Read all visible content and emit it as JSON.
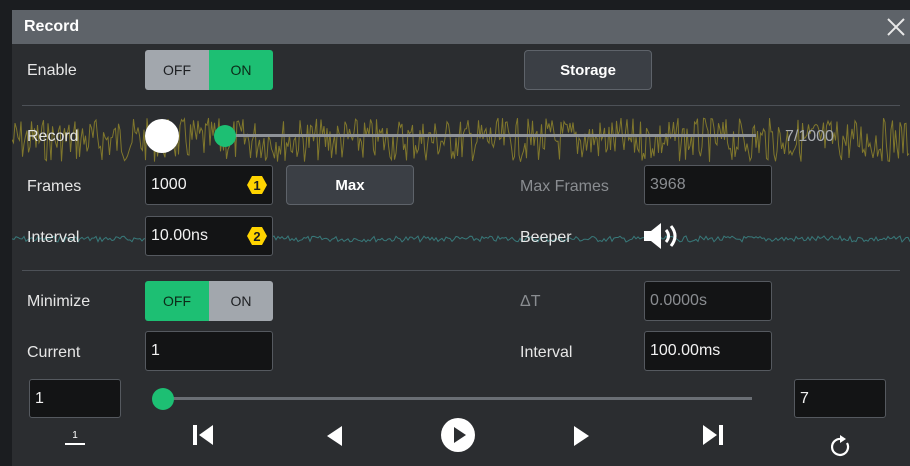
{
  "dialog": {
    "title": "Record"
  },
  "enable": {
    "label": "Enable",
    "off_label": "OFF",
    "on_label": "ON",
    "state": "on"
  },
  "storage_button": {
    "label": "Storage"
  },
  "record": {
    "label": "Record",
    "progress_text": "7/1000",
    "progress_fraction": 0.007
  },
  "frames": {
    "label": "Frames",
    "value": "1000",
    "badge": "1"
  },
  "max_button": {
    "label": "Max"
  },
  "max_frames": {
    "label": "Max Frames",
    "value": "3968"
  },
  "interval_top": {
    "label": "Interval",
    "value": "10.00ns",
    "badge": "2"
  },
  "beeper": {
    "label": "Beeper",
    "icon": "speaker-icon"
  },
  "minimize": {
    "label": "Minimize",
    "off_label": "OFF",
    "on_label": "ON",
    "state": "off"
  },
  "delta_t": {
    "label": "ΔT",
    "value": "0.0000s"
  },
  "current": {
    "label": "Current",
    "value": "1"
  },
  "interval_bottom": {
    "label": "Interval",
    "value": "100.00ms"
  },
  "range": {
    "start": "1",
    "end": "7",
    "position_fraction": 0.0
  },
  "playback": {
    "icons": [
      "set-start-icon",
      "skip-to-first-icon",
      "step-back-icon",
      "play-icon",
      "step-forward-icon",
      "skip-to-last-icon",
      "repeat-icon"
    ]
  },
  "colors": {
    "accent_green": "#1dbf73",
    "badge_yellow": "#ffd400",
    "waveform_yellow": "#c6b52a",
    "waveform_teal": "#3f9a9a"
  }
}
